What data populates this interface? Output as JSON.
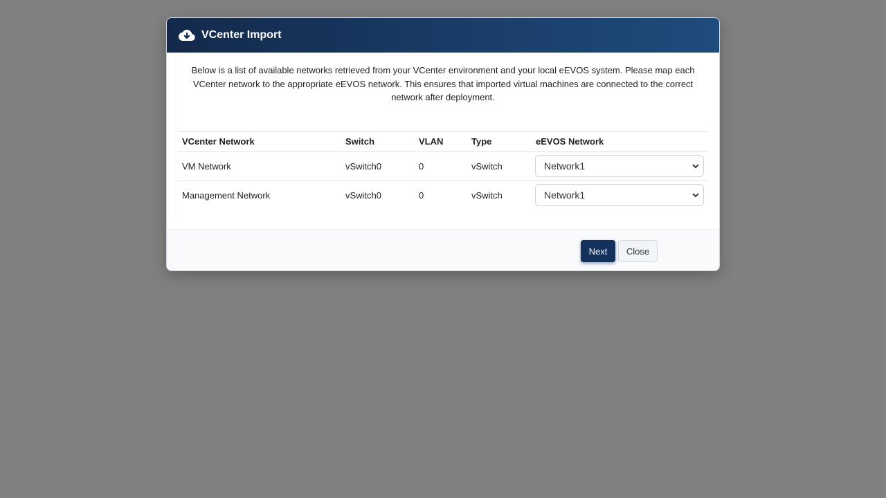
{
  "modal": {
    "title": "VCenter Import",
    "header_icon": "cloud-download-icon",
    "intro": "Below is a list of available networks retrieved from your VCenter environment and your local eEVOS system. Please map each VCenter network to the appropriate eEVOS network. This ensures that imported virtual machines are connected to the correct network after deployment."
  },
  "table": {
    "headers": {
      "vcenter_network": "VCenter Network",
      "switch": "Switch",
      "vlan": "VLAN",
      "type": "Type",
      "eevos_network": "eEVOS Network"
    },
    "rows": [
      {
        "vcenter_network": "VM Network",
        "switch": "vSwitch0",
        "vlan": "0",
        "type": "vSwitch",
        "eevos_network": "Network1"
      },
      {
        "vcenter_network": "Management Network",
        "switch": "vSwitch0",
        "vlan": "0",
        "type": "vSwitch",
        "eevos_network": "Network1"
      }
    ]
  },
  "footer": {
    "next_label": "Next",
    "close_label": "Close"
  },
  "colors": {
    "header_start": "#13294b",
    "header_end": "#1e4c7c",
    "primary_button": "#13315c",
    "backdrop": "#808080"
  }
}
